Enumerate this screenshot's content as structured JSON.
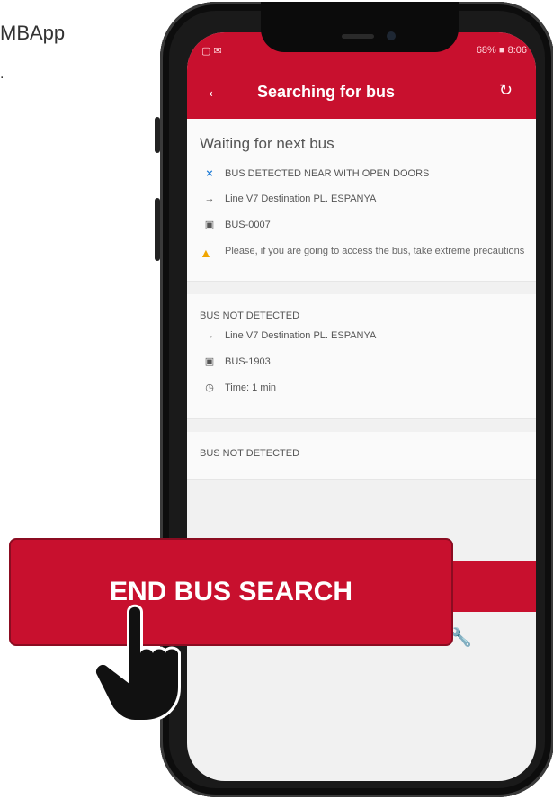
{
  "background": {
    "caption_line1": "MBApp",
    "caption_line2": "."
  },
  "status_bar": {
    "left": "▢ ✉",
    "right": "68% ■ 8:06"
  },
  "app_bar": {
    "back_icon": "arrow-left-icon",
    "title": "Searching for bus",
    "refresh_icon": "refresh-icon"
  },
  "main": {
    "heading": "Waiting for next bus",
    "detected": {
      "bluetooth_text": "BUS DETECTED NEAR WITH OPEN DOORS",
      "line_text": "Line V7  Destination PL. ESPANYA",
      "bus_id": "BUS-0007",
      "warning": "Please, if you are going to access the bus, take extreme precautions"
    },
    "not_detected_1": {
      "label": "BUS NOT DETECTED",
      "line_text": "Line V7  Destination PL. ESPANYA",
      "bus_id": "BUS-1903",
      "time": "Time: 1 min"
    },
    "not_detected_2": {
      "label": "BUS NOT DETECTED"
    }
  },
  "overlay": {
    "end_button_label": "END BUS SEARCH"
  },
  "colors": {
    "brand_red": "#c8102e",
    "warning": "#f0a500",
    "bluetooth": "#1e7bd6"
  }
}
